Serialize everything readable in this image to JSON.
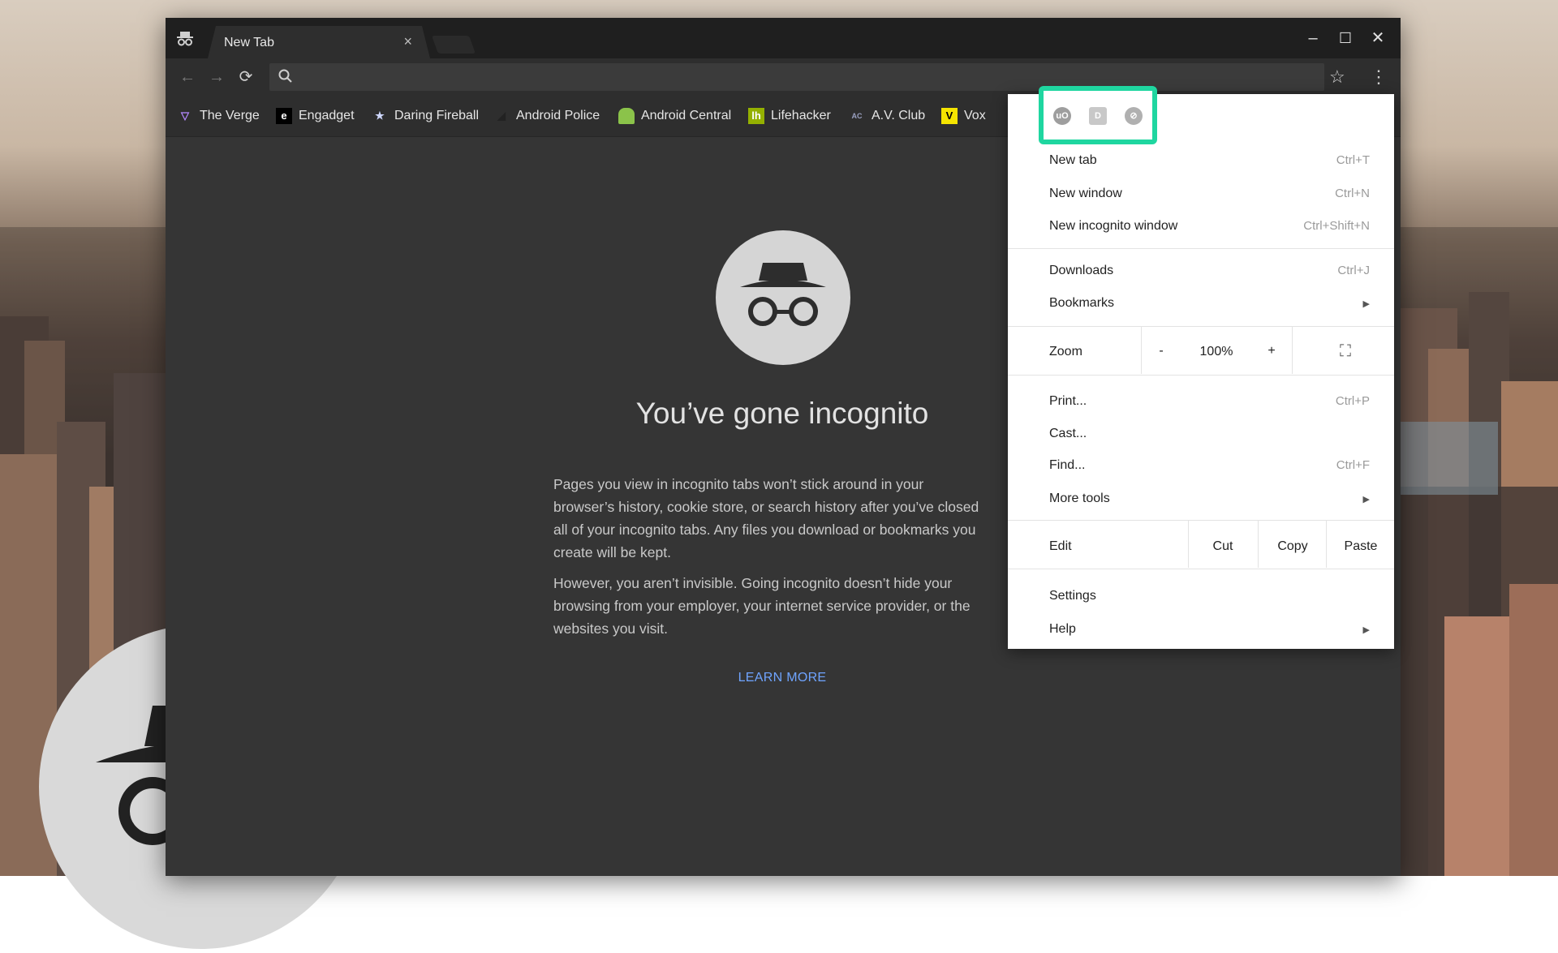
{
  "browser": {
    "tab_title": "New Tab",
    "tab_close": "×",
    "window_controls": {
      "minimize": "–",
      "maximize": "☐",
      "close": "✕"
    },
    "toolbar": {
      "back": "←",
      "forward": "→",
      "reload": "⟳",
      "star": "☆",
      "menu": "⋮"
    }
  },
  "bookmarks": [
    {
      "label": "The Verge",
      "icon": "verge-logo-icon",
      "color": "#9b59ff"
    },
    {
      "label": "Engadget",
      "icon": "engadget-logo-icon",
      "color": "#000000"
    },
    {
      "label": "Daring Fireball",
      "icon": "star-icon",
      "color": "#4a4a4a"
    },
    {
      "label": "Android Police",
      "icon": "android-police-icon",
      "color": "#333333"
    },
    {
      "label": "Android Central",
      "icon": "android-icon",
      "color": "#8bc34a"
    },
    {
      "label": "Lifehacker",
      "icon": "lifehacker-icon",
      "color": "#94b000"
    },
    {
      "label": "A.V. Club",
      "icon": "av-club-icon",
      "color": "#3a3a5a"
    },
    {
      "label": "Vox",
      "icon": "vox-icon",
      "color": "#f5e400"
    }
  ],
  "incognito": {
    "heading": "You’ve gone incognito",
    "paragraph1_lines": [
      "Pages you view in incognito tabs won’t stick around in your",
      "browser’s history, cookie store, or search history after you’ve closed",
      "all of your incognito tabs. Any files you download or bookmarks you",
      "create will be kept."
    ],
    "paragraph2_lines": [
      "However, you aren’t invisible. Going incognito doesn’t hide your",
      "browsing from your employer, your internet service provider, or the",
      "websites you visit."
    ],
    "learn_more": "LEARN MORE"
  },
  "menu": {
    "extensions": [
      {
        "icon": "ublock-extension-icon",
        "glyph": "uO"
      },
      {
        "icon": "d-extension-icon",
        "glyph": "D"
      },
      {
        "icon": "circle-extension-icon",
        "glyph": "⊘"
      }
    ],
    "highlight_color": "#1fd6a0",
    "items_group1": [
      {
        "label": "New tab",
        "shortcut": "Ctrl+T"
      },
      {
        "label": "New window",
        "shortcut": "Ctrl+N"
      },
      {
        "label": "New incognito window",
        "shortcut": "Ctrl+Shift+N"
      }
    ],
    "items_group2": [
      {
        "label": "Downloads",
        "shortcut": "Ctrl+J"
      },
      {
        "label": "Bookmarks",
        "shortcut": "▶"
      }
    ],
    "zoom": {
      "label": "Zoom",
      "minus": "-",
      "value": "100%",
      "plus": "+",
      "fullscreen": "⛶"
    },
    "items_group3": [
      {
        "label": "Print...",
        "shortcut": "Ctrl+P"
      },
      {
        "label": "Cast...",
        "shortcut": ""
      },
      {
        "label": "Find...",
        "shortcut": "Ctrl+F"
      },
      {
        "label": "More tools",
        "shortcut": "▶"
      }
    ],
    "edit": {
      "label": "Edit",
      "cut": "Cut",
      "copy": "Copy",
      "paste": "Paste"
    },
    "items_group4": [
      {
        "label": "Settings",
        "shortcut": ""
      },
      {
        "label": "Help",
        "shortcut": "▶"
      }
    ]
  }
}
